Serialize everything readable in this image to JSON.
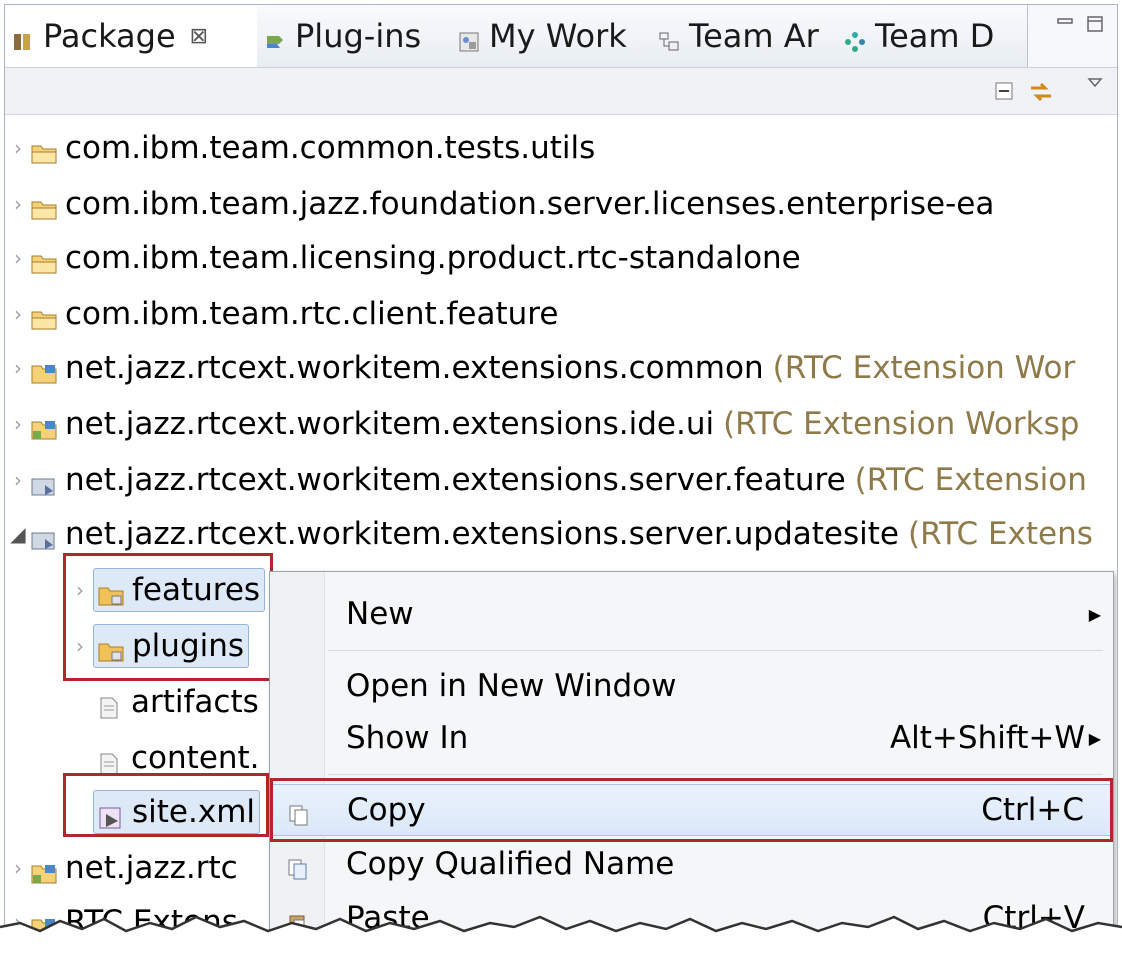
{
  "tabs": [
    {
      "label": "Package",
      "close": "⊠",
      "icon": "package-explorer-icon"
    },
    {
      "label": "Plug-ins",
      "icon": "plugins-icon"
    },
    {
      "label": "My Work",
      "icon": "my-work-icon"
    },
    {
      "label": "Team Ar",
      "icon": "team-artifacts-icon"
    },
    {
      "label": "Team D",
      "icon": "team-dashboard-icon"
    }
  ],
  "tree": [
    {
      "label": "com.ibm.team.common.tests.utils",
      "deco": "",
      "icon": "project-folder-icon"
    },
    {
      "label": "com.ibm.team.jazz.foundation.server.licenses.enterprise-ea",
      "deco": "",
      "icon": "project-folder-icon"
    },
    {
      "label": "com.ibm.team.licensing.product.rtc-standalone",
      "deco": "",
      "icon": "project-folder-icon"
    },
    {
      "label": "com.ibm.team.rtc.client.feature",
      "deco": "",
      "icon": "project-folder-icon"
    },
    {
      "label": "net.jazz.rtcext.workitem.extensions.common",
      "deco": "(RTC Extension Wor",
      "icon": "plugin-project-icon"
    },
    {
      "label": "net.jazz.rtcext.workitem.extensions.ide.ui",
      "deco": "(RTC Extension Worksp",
      "icon": "plugin-project-icon"
    },
    {
      "label": "net.jazz.rtcext.workitem.extensions.server.feature",
      "deco": "(RTC Extension",
      "icon": "feature-project-icon"
    },
    {
      "label": "net.jazz.rtcext.workitem.extensions.server.updatesite",
      "deco": "(RTC Extens",
      "icon": "updatesite-project-icon"
    }
  ],
  "children": [
    {
      "label": "features",
      "icon": "folder-icon"
    },
    {
      "label": "plugins",
      "icon": "folder-icon"
    },
    {
      "label": "artifacts",
      "icon": "file-icon"
    },
    {
      "label": "content.",
      "icon": "file-icon"
    },
    {
      "label": "site.xml",
      "icon": "site-xml-icon"
    }
  ],
  "tail": [
    {
      "label": "net.jazz.rtc",
      "icon": "plugin-project-icon"
    },
    {
      "label": "RTC Extens",
      "icon": "project-folder-icon"
    }
  ],
  "menu": {
    "new": "New",
    "open_new_window": "Open in New Window",
    "show_in": "Show In",
    "show_in_shortcut": "Alt+Shift+W",
    "copy": "Copy",
    "copy_shortcut": "Ctrl+C",
    "copy_qualified": "Copy Qualified Name",
    "paste": "Paste",
    "paste_shortcut": "Ctrl+V"
  },
  "colors": {
    "decoration": "#8f7a4a",
    "highlight": "#b3262e",
    "selection": "#dde9f7"
  }
}
